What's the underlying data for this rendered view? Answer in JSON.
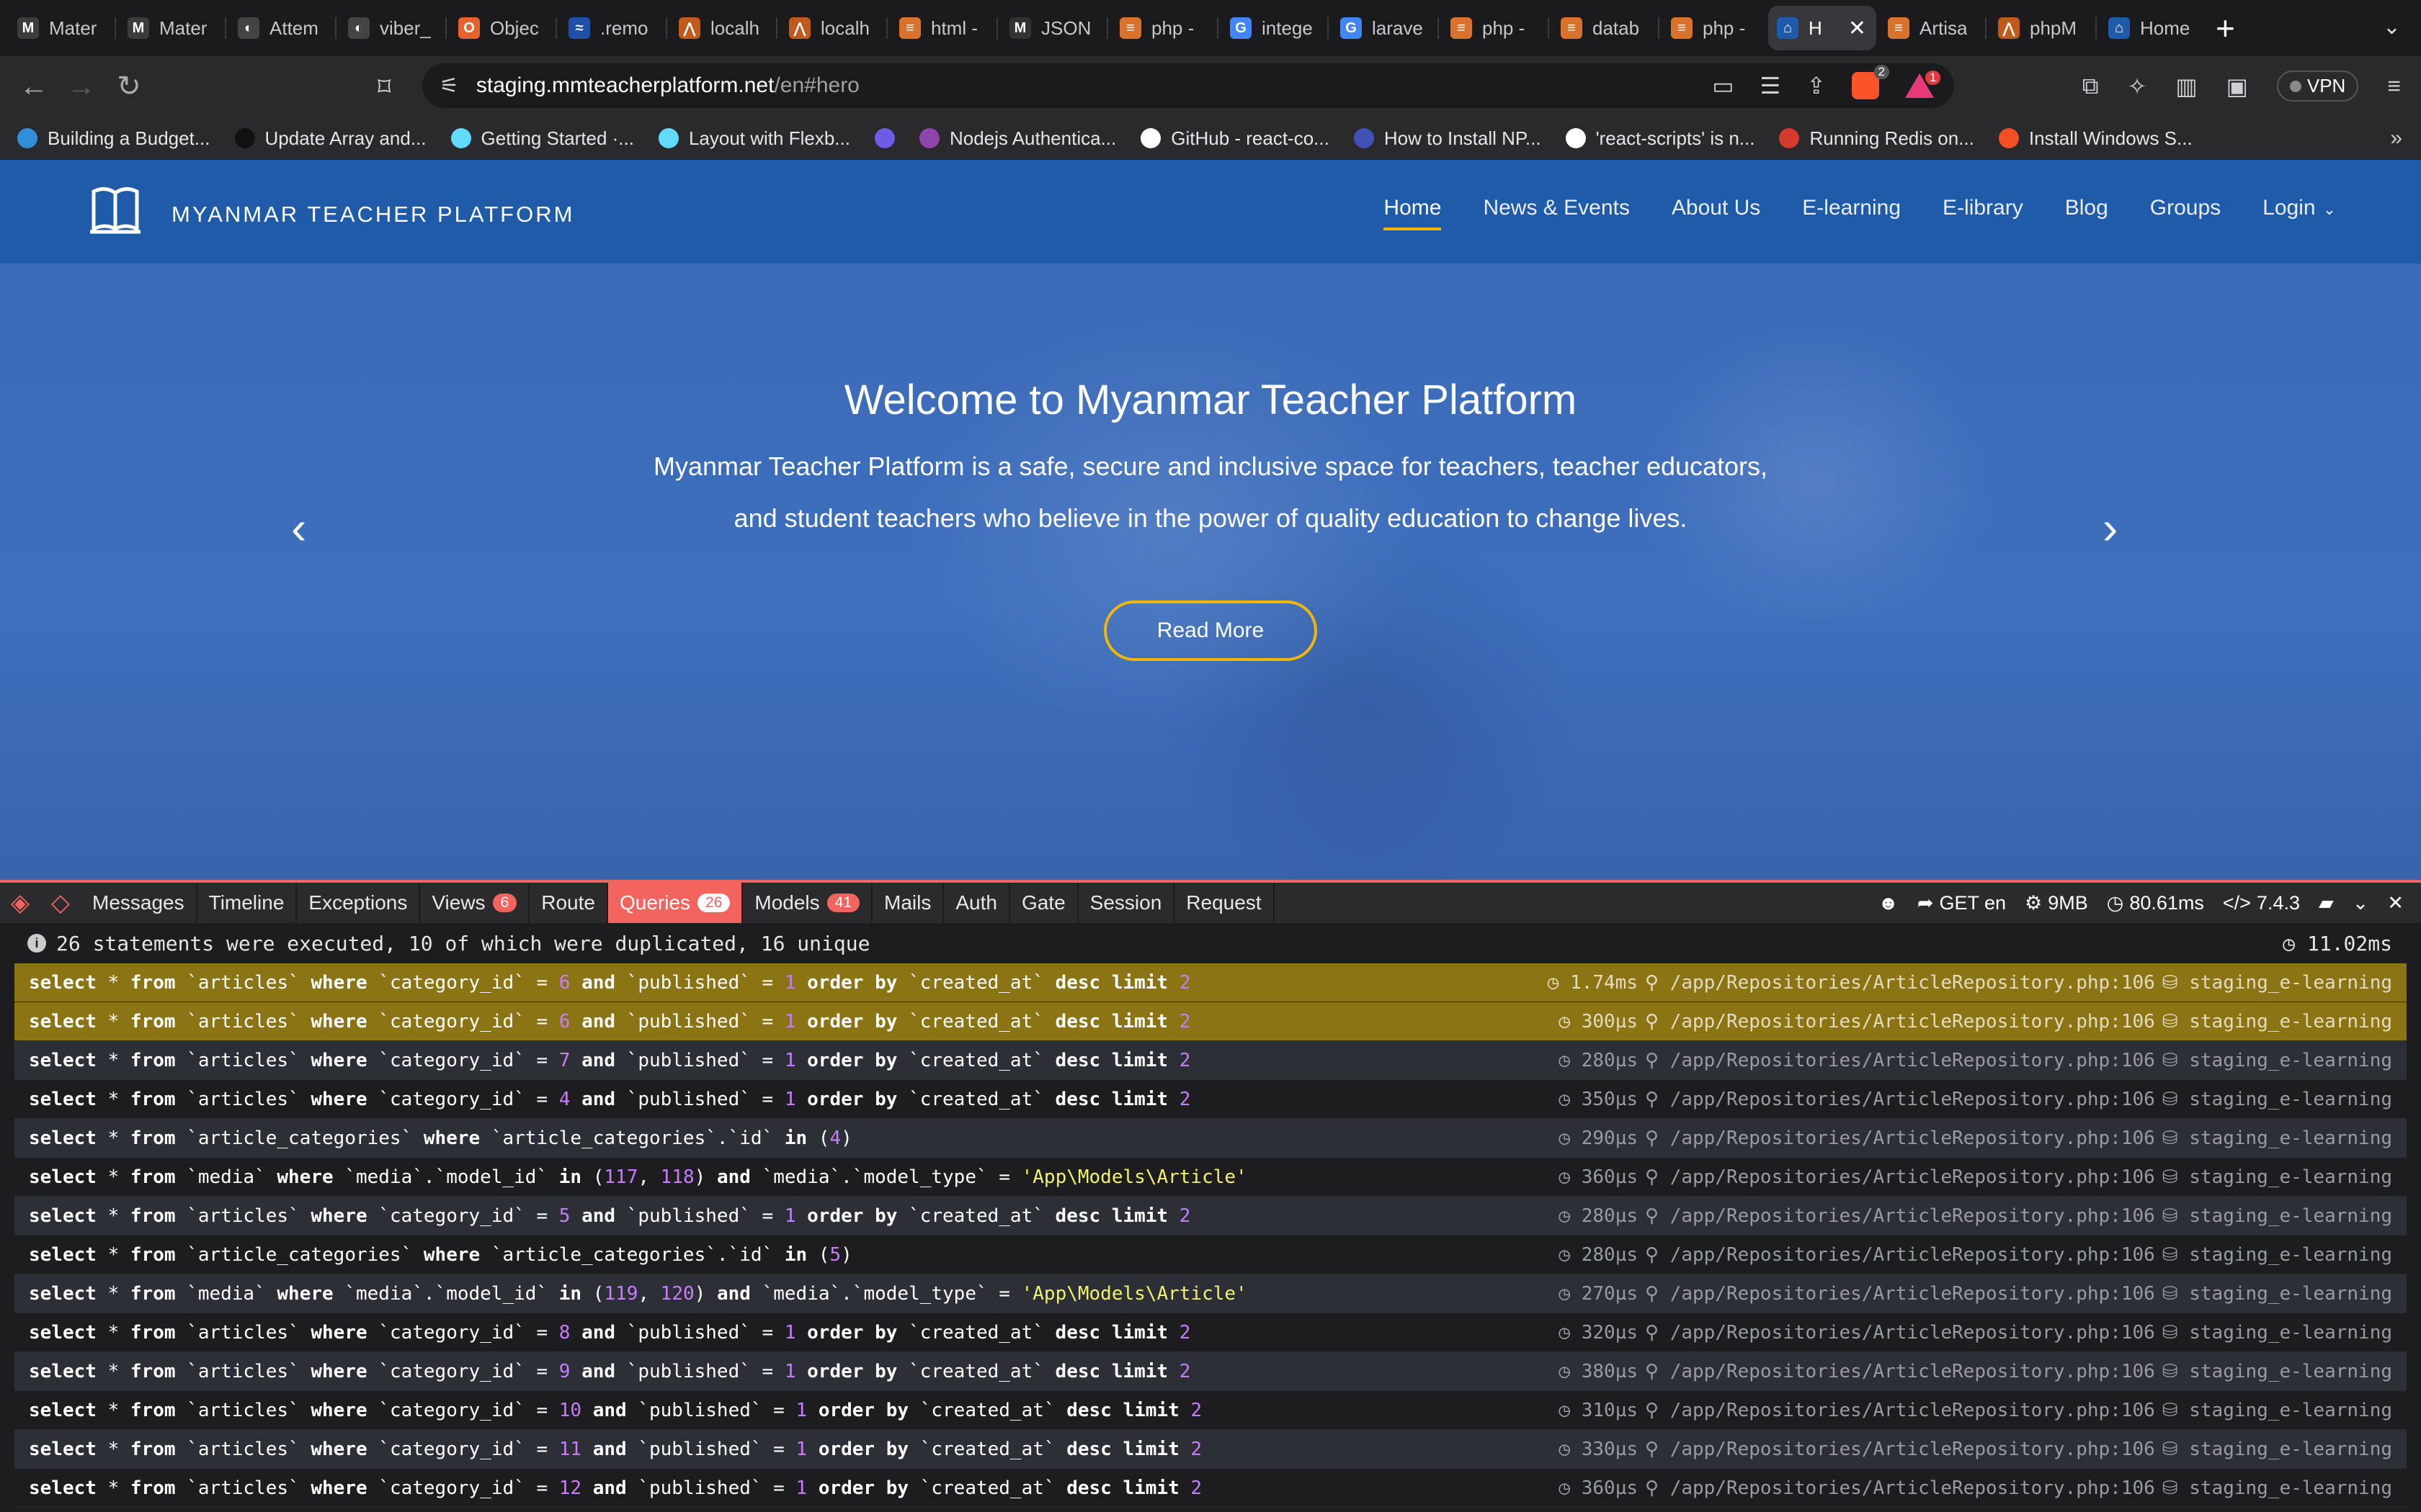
{
  "browser": {
    "tabs": [
      {
        "title": "Mater",
        "fav": "M",
        "color": "#3c3c3c"
      },
      {
        "title": "Mater",
        "fav": "M",
        "color": "#3c3c3c"
      },
      {
        "title": "Attem",
        "fav": "◐",
        "color": "#444"
      },
      {
        "title": "viber_",
        "fav": "◐",
        "color": "#444"
      },
      {
        "title": "Objec",
        "fav": "O",
        "color": "#e8622c"
      },
      {
        "title": ".remo",
        "fav": "≈",
        "color": "#1f4fa8"
      },
      {
        "title": "localh",
        "fav": "⋀",
        "color": "#c05a1c"
      },
      {
        "title": "localh",
        "fav": "⋀",
        "color": "#c05a1c"
      },
      {
        "title": "html -",
        "fav": "≡",
        "color": "#d9722d"
      },
      {
        "title": "JSON",
        "fav": "M",
        "color": "#333"
      },
      {
        "title": "php -",
        "fav": "≡",
        "color": "#d9722d"
      },
      {
        "title": "intege",
        "fav": "G",
        "color": "#4285f4"
      },
      {
        "title": "larave",
        "fav": "G",
        "color": "#4285f4"
      },
      {
        "title": "php -",
        "fav": "≡",
        "color": "#d9722d"
      },
      {
        "title": "datab",
        "fav": "≡",
        "color": "#d9722d"
      },
      {
        "title": "php -",
        "fav": "≡",
        "color": "#d9722d"
      },
      {
        "title": "H",
        "fav": "⌂",
        "color": "#1f5ba8",
        "active": true
      },
      {
        "title": "Artisa",
        "fav": "≡",
        "color": "#d9722d"
      },
      {
        "title": "phpM",
        "fav": "⋀",
        "color": "#c05a1c"
      },
      {
        "title": "Home",
        "fav": "⌂",
        "color": "#1f5ba8"
      }
    ],
    "url_host": "staging.mmteacherplatform.net",
    "url_path": "/en#hero",
    "brave_badge": "2",
    "rewards_badge": "1",
    "vpn_label": "VPN",
    "bookmarks": [
      {
        "label": "Building a Budget...",
        "color": "#2f8fd8"
      },
      {
        "label": "Update Array and...",
        "color": "#111"
      },
      {
        "label": "Getting Started ·...",
        "color": "#61dafb"
      },
      {
        "label": "Layout with Flexb...",
        "color": "#61dafb"
      },
      {
        "label": "",
        "color": "#6c5ce7"
      },
      {
        "label": "Nodejs Authentica...",
        "color": "#8e44ad"
      },
      {
        "label": "GitHub - react-co...",
        "color": "#fff"
      },
      {
        "label": "How to Install NP...",
        "color": "#3f51b5"
      },
      {
        "label": "'react-scripts' is n...",
        "color": "#fff"
      },
      {
        "label": "Running Redis on...",
        "color": "#d63a2c"
      },
      {
        "label": "Install Windows S...",
        "color": "#f25022"
      }
    ]
  },
  "site": {
    "brand": "MYANMAR TEACHER PLATFORM",
    "nav": [
      {
        "label": "Home",
        "active": true
      },
      {
        "label": "News & Events"
      },
      {
        "label": "About Us"
      },
      {
        "label": "E-learning"
      },
      {
        "label": "E-library"
      },
      {
        "label": "Blog"
      },
      {
        "label": "Groups"
      },
      {
        "label": "Login",
        "dropdown": true
      }
    ],
    "hero": {
      "title": "Welcome to Myanmar Teacher Platform",
      "text": "Myanmar Teacher Platform is a safe, secure and inclusive space for teachers, teacher educators, and student teachers who believe in the power of quality education to change lives.",
      "button": "Read More",
      "prev_icon": "‹",
      "next_icon": "›"
    }
  },
  "debugbar": {
    "tabs": [
      {
        "label": "Messages"
      },
      {
        "label": "Timeline"
      },
      {
        "label": "Exceptions"
      },
      {
        "label": "Views",
        "count": "6"
      },
      {
        "label": "Route"
      },
      {
        "label": "Queries",
        "count": "26",
        "active": true
      },
      {
        "label": "Models",
        "count": "41"
      },
      {
        "label": "Mails"
      },
      {
        "label": "Auth"
      },
      {
        "label": "Gate"
      },
      {
        "label": "Session"
      },
      {
        "label": "Request"
      }
    ],
    "request": "GET en",
    "memory": "9MB",
    "duration": "80.61ms",
    "php_version": "7.4.3",
    "summary": "26 statements were executed, 10 of which were duplicated, 16 unique",
    "total_time": "11.02ms",
    "file": "/app/Repositories/ArticleRepository.php:106",
    "connection": "staging_e-learning",
    "queries": [
      {
        "sql": [
          [
            "select",
            "kw"
          ],
          [
            " * ",
            "p"
          ],
          [
            "from",
            "kw"
          ],
          [
            " `articles` ",
            "p"
          ],
          [
            "where",
            "kw"
          ],
          [
            " `category_id` = ",
            "p"
          ],
          [
            "6",
            "n"
          ],
          [
            " ",
            "p"
          ],
          [
            "and",
            "kw"
          ],
          [
            " `published` = ",
            "p"
          ],
          [
            "1",
            "n"
          ],
          [
            " ",
            "p"
          ],
          [
            "order by",
            "kw"
          ],
          [
            " `created_at` ",
            "p"
          ],
          [
            "desc limit",
            "kw"
          ],
          [
            " ",
            "p"
          ],
          [
            "2",
            "n"
          ]
        ],
        "time": "1.74ms",
        "dup": true
      },
      {
        "sql": [
          [
            "select",
            "kw"
          ],
          [
            " * ",
            "p"
          ],
          [
            "from",
            "kw"
          ],
          [
            " `articles` ",
            "p"
          ],
          [
            "where",
            "kw"
          ],
          [
            " `category_id` = ",
            "p"
          ],
          [
            "6",
            "n"
          ],
          [
            " ",
            "p"
          ],
          [
            "and",
            "kw"
          ],
          [
            " `published` = ",
            "p"
          ],
          [
            "1",
            "n"
          ],
          [
            " ",
            "p"
          ],
          [
            "order by",
            "kw"
          ],
          [
            " `created_at` ",
            "p"
          ],
          [
            "desc limit",
            "kw"
          ],
          [
            " ",
            "p"
          ],
          [
            "2",
            "n"
          ]
        ],
        "time": "300µs",
        "dup": true
      },
      {
        "sql": [
          [
            "select",
            "kw"
          ],
          [
            " * ",
            "p"
          ],
          [
            "from",
            "kw"
          ],
          [
            " `articles` ",
            "p"
          ],
          [
            "where",
            "kw"
          ],
          [
            " `category_id` = ",
            "p"
          ],
          [
            "7",
            "n"
          ],
          [
            " ",
            "p"
          ],
          [
            "and",
            "kw"
          ],
          [
            " `published` = ",
            "p"
          ],
          [
            "1",
            "n"
          ],
          [
            " ",
            "p"
          ],
          [
            "order by",
            "kw"
          ],
          [
            " `created_at` ",
            "p"
          ],
          [
            "desc limit",
            "kw"
          ],
          [
            " ",
            "p"
          ],
          [
            "2",
            "n"
          ]
        ],
        "time": "280µs"
      },
      {
        "sql": [
          [
            "select",
            "kw"
          ],
          [
            " * ",
            "p"
          ],
          [
            "from",
            "kw"
          ],
          [
            " `articles` ",
            "p"
          ],
          [
            "where",
            "kw"
          ],
          [
            " `category_id` = ",
            "p"
          ],
          [
            "4",
            "n"
          ],
          [
            " ",
            "p"
          ],
          [
            "and",
            "kw"
          ],
          [
            " `published` = ",
            "p"
          ],
          [
            "1",
            "n"
          ],
          [
            " ",
            "p"
          ],
          [
            "order by",
            "kw"
          ],
          [
            " `created_at` ",
            "p"
          ],
          [
            "desc limit",
            "kw"
          ],
          [
            " ",
            "p"
          ],
          [
            "2",
            "n"
          ]
        ],
        "time": "350µs"
      },
      {
        "sql": [
          [
            "select",
            "kw"
          ],
          [
            " * ",
            "p"
          ],
          [
            "from",
            "kw"
          ],
          [
            " `article_categories` ",
            "p"
          ],
          [
            "where",
            "kw"
          ],
          [
            " `article_categories`.`id` ",
            "p"
          ],
          [
            "in",
            "kw"
          ],
          [
            " (",
            "p"
          ],
          [
            "4",
            "n"
          ],
          [
            ")",
            "p"
          ]
        ],
        "time": "290µs"
      },
      {
        "sql": [
          [
            "select",
            "kw"
          ],
          [
            " * ",
            "p"
          ],
          [
            "from",
            "kw"
          ],
          [
            " `media` ",
            "p"
          ],
          [
            "where",
            "kw"
          ],
          [
            " `media`.`model_id` ",
            "p"
          ],
          [
            "in",
            "kw"
          ],
          [
            " (",
            "p"
          ],
          [
            "117",
            "n"
          ],
          [
            ", ",
            "p"
          ],
          [
            "118",
            "n"
          ],
          [
            ") ",
            "p"
          ],
          [
            "and",
            "kw"
          ],
          [
            " `media`.`model_type` = ",
            "p"
          ],
          [
            "'App\\Models\\Article'",
            "s"
          ]
        ],
        "time": "360µs"
      },
      {
        "sql": [
          [
            "select",
            "kw"
          ],
          [
            " * ",
            "p"
          ],
          [
            "from",
            "kw"
          ],
          [
            " `articles` ",
            "p"
          ],
          [
            "where",
            "kw"
          ],
          [
            " `category_id` = ",
            "p"
          ],
          [
            "5",
            "n"
          ],
          [
            " ",
            "p"
          ],
          [
            "and",
            "kw"
          ],
          [
            " `published` = ",
            "p"
          ],
          [
            "1",
            "n"
          ],
          [
            " ",
            "p"
          ],
          [
            "order by",
            "kw"
          ],
          [
            " `created_at` ",
            "p"
          ],
          [
            "desc limit",
            "kw"
          ],
          [
            " ",
            "p"
          ],
          [
            "2",
            "n"
          ]
        ],
        "time": "280µs"
      },
      {
        "sql": [
          [
            "select",
            "kw"
          ],
          [
            " * ",
            "p"
          ],
          [
            "from",
            "kw"
          ],
          [
            " `article_categories` ",
            "p"
          ],
          [
            "where",
            "kw"
          ],
          [
            " `article_categories`.`id` ",
            "p"
          ],
          [
            "in",
            "kw"
          ],
          [
            " (",
            "p"
          ],
          [
            "5",
            "n"
          ],
          [
            ")",
            "p"
          ]
        ],
        "time": "280µs"
      },
      {
        "sql": [
          [
            "select",
            "kw"
          ],
          [
            " * ",
            "p"
          ],
          [
            "from",
            "kw"
          ],
          [
            " `media` ",
            "p"
          ],
          [
            "where",
            "kw"
          ],
          [
            " `media`.`model_id` ",
            "p"
          ],
          [
            "in",
            "kw"
          ],
          [
            " (",
            "p"
          ],
          [
            "119",
            "n"
          ],
          [
            ", ",
            "p"
          ],
          [
            "120",
            "n"
          ],
          [
            ") ",
            "p"
          ],
          [
            "and",
            "kw"
          ],
          [
            " `media`.`model_type` = ",
            "p"
          ],
          [
            "'App\\Models\\Article'",
            "s"
          ]
        ],
        "time": "270µs"
      },
      {
        "sql": [
          [
            "select",
            "kw"
          ],
          [
            " * ",
            "p"
          ],
          [
            "from",
            "kw"
          ],
          [
            " `articles` ",
            "p"
          ],
          [
            "where",
            "kw"
          ],
          [
            " `category_id` = ",
            "p"
          ],
          [
            "8",
            "n"
          ],
          [
            " ",
            "p"
          ],
          [
            "and",
            "kw"
          ],
          [
            " `published` = ",
            "p"
          ],
          [
            "1",
            "n"
          ],
          [
            " ",
            "p"
          ],
          [
            "order by",
            "kw"
          ],
          [
            " `created_at` ",
            "p"
          ],
          [
            "desc limit",
            "kw"
          ],
          [
            " ",
            "p"
          ],
          [
            "2",
            "n"
          ]
        ],
        "time": "320µs"
      },
      {
        "sql": [
          [
            "select",
            "kw"
          ],
          [
            " * ",
            "p"
          ],
          [
            "from",
            "kw"
          ],
          [
            " `articles` ",
            "p"
          ],
          [
            "where",
            "kw"
          ],
          [
            " `category_id` = ",
            "p"
          ],
          [
            "9",
            "n"
          ],
          [
            " ",
            "p"
          ],
          [
            "and",
            "kw"
          ],
          [
            " `published` = ",
            "p"
          ],
          [
            "1",
            "n"
          ],
          [
            " ",
            "p"
          ],
          [
            "order by",
            "kw"
          ],
          [
            " `created_at` ",
            "p"
          ],
          [
            "desc limit",
            "kw"
          ],
          [
            " ",
            "p"
          ],
          [
            "2",
            "n"
          ]
        ],
        "time": "380µs"
      },
      {
        "sql": [
          [
            "select",
            "kw"
          ],
          [
            " * ",
            "p"
          ],
          [
            "from",
            "kw"
          ],
          [
            " `articles` ",
            "p"
          ],
          [
            "where",
            "kw"
          ],
          [
            " `category_id` = ",
            "p"
          ],
          [
            "10",
            "n"
          ],
          [
            " ",
            "p"
          ],
          [
            "and",
            "kw"
          ],
          [
            " `published` = ",
            "p"
          ],
          [
            "1",
            "n"
          ],
          [
            " ",
            "p"
          ],
          [
            "order by",
            "kw"
          ],
          [
            " `created_at` ",
            "p"
          ],
          [
            "desc limit",
            "kw"
          ],
          [
            " ",
            "p"
          ],
          [
            "2",
            "n"
          ]
        ],
        "time": "310µs"
      },
      {
        "sql": [
          [
            "select",
            "kw"
          ],
          [
            " * ",
            "p"
          ],
          [
            "from",
            "kw"
          ],
          [
            " `articles` ",
            "p"
          ],
          [
            "where",
            "kw"
          ],
          [
            " `category_id` = ",
            "p"
          ],
          [
            "11",
            "n"
          ],
          [
            " ",
            "p"
          ],
          [
            "and",
            "kw"
          ],
          [
            " `published` = ",
            "p"
          ],
          [
            "1",
            "n"
          ],
          [
            " ",
            "p"
          ],
          [
            "order by",
            "kw"
          ],
          [
            " `created_at` ",
            "p"
          ],
          [
            "desc limit",
            "kw"
          ],
          [
            " ",
            "p"
          ],
          [
            "2",
            "n"
          ]
        ],
        "time": "330µs"
      },
      {
        "sql": [
          [
            "select",
            "kw"
          ],
          [
            " * ",
            "p"
          ],
          [
            "from",
            "kw"
          ],
          [
            " `articles` ",
            "p"
          ],
          [
            "where",
            "kw"
          ],
          [
            " `category_id` = ",
            "p"
          ],
          [
            "12",
            "n"
          ],
          [
            " ",
            "p"
          ],
          [
            "and",
            "kw"
          ],
          [
            " `published` = ",
            "p"
          ],
          [
            "1",
            "n"
          ],
          [
            " ",
            "p"
          ],
          [
            "order by",
            "kw"
          ],
          [
            " `created_at` ",
            "p"
          ],
          [
            "desc limit",
            "kw"
          ],
          [
            " ",
            "p"
          ],
          [
            "2",
            "n"
          ]
        ],
        "time": "360µs"
      }
    ]
  }
}
